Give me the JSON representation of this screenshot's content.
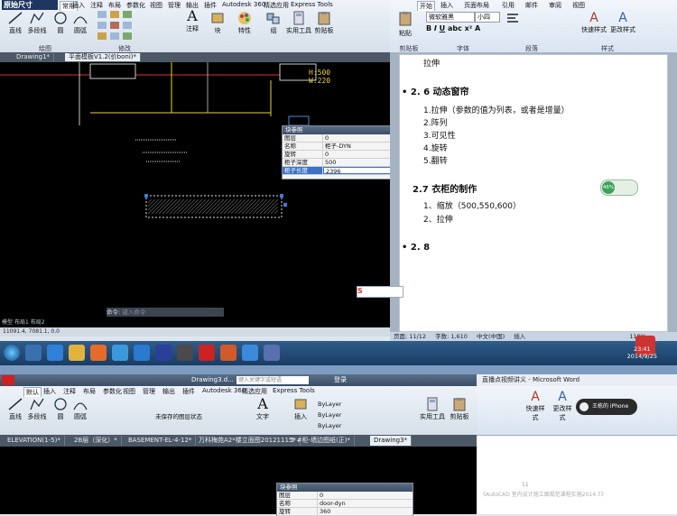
{
  "top_acad": {
    "title_overlay": "原始尺寸",
    "tabs": [
      "常用",
      "插入",
      "注释",
      "布局",
      "参数化",
      "视图",
      "管理",
      "输出",
      "插件",
      "Autodesk 360",
      "精选应用",
      "Express Tools"
    ],
    "tools": [
      "直线",
      "多段线",
      "圆",
      "圆弧",
      "注释",
      "块",
      "特性",
      "组",
      "实用工具",
      "剪贴板"
    ],
    "groups": [
      "绘图",
      "修改"
    ],
    "doc_tabs": [
      "Drawing1*",
      "平面模板V1.2(价boni)*"
    ],
    "dim_text_1": "H:500",
    "dim_text_2": "W:220",
    "command_label": "命令:",
    "command_placeholder": "键入命令",
    "status_text": "11091.4, 7081.1, 0.0",
    "status_tabs": [
      "模型",
      "布局1",
      "布局2"
    ],
    "block_panel": {
      "title": "块参照",
      "rows": [
        {
          "k": "图层",
          "v": "0"
        },
        {
          "k": "名称",
          "v": "柜子-DYN"
        },
        {
          "k": "旋转",
          "v": "0"
        },
        {
          "k": "柜子深度",
          "v": "500"
        },
        {
          "k": "柜子长度",
          "v": "2396"
        }
      ]
    }
  },
  "top_word": {
    "tabs": [
      "开始",
      "插入",
      "页面布局",
      "引用",
      "邮件",
      "审阅",
      "视图"
    ],
    "font_name": "微软雅黑",
    "font_size": "小四",
    "groups": [
      "剪贴板",
      "字体",
      "段落",
      "样式"
    ],
    "style_buttons": [
      "快速样式",
      "更改样式"
    ],
    "paste_label": "粘贴",
    "lines": [
      {
        "t": "拉伸",
        "h": false
      },
      {
        "t": "• 2. 6 动态窗帘",
        "h": true
      },
      {
        "t": "1.拉伸（参数的值为列表，或者是增量）",
        "h": false
      },
      {
        "t": "2.阵列",
        "h": false
      },
      {
        "t": "3.可见性",
        "h": false
      },
      {
        "t": "4.旋转",
        "h": false
      },
      {
        "t": "5.翻转",
        "h": false
      },
      {
        "t": "2.7 衣柜的制作",
        "h": true
      },
      {
        "t": "1、缩放（500,550,600）",
        "h": false
      },
      {
        "t": "2、拉伸",
        "h": false
      },
      {
        "t": "• 2. 8",
        "h": true
      }
    ],
    "status_page": "页面: 11/12",
    "status_words": "字数: 1,610",
    "status_lang": "中文(中国)",
    "status_mode": "插入",
    "zoom": "110%",
    "net_percent": "46%"
  },
  "taskbar": {
    "time": "23:41",
    "date": "2014/9/25"
  },
  "bottom_acad": {
    "title": "Drawing3.d...",
    "search_placeholder": "键入关键字或短语",
    "login": "登录",
    "tabs": [
      "默认",
      "插入",
      "注释",
      "布局",
      "参数化",
      "视图",
      "管理",
      "输出",
      "插件",
      "Autodesk 360",
      "精选应用",
      "Express Tools"
    ],
    "tools": [
      "直线",
      "多段线",
      "圆",
      "圆弧",
      "文字",
      "插入",
      "特性匹配",
      "实用工具",
      "剪贴板"
    ],
    "layer_label": "未保存的图层状态",
    "bylayer": "ByLayer",
    "groups": [
      "绘图",
      "修改",
      "图层",
      "注释",
      "块",
      "特性",
      "组"
    ],
    "doc_tabs": [
      "ELEVATION(1-5)*",
      "2B层（深化）*",
      "BASEMENT-EL-4-12*",
      "万科梅苑A2*楼立面图20121115*",
      "5 #柜-墙边图纸(正)*",
      "Drawing3*"
    ],
    "block_panel": {
      "title": "块参照",
      "rows": [
        {
          "k": "图层",
          "v": "0"
        },
        {
          "k": "名称",
          "v": "door-dyn"
        },
        {
          "k": "旋转",
          "v": "360"
        }
      ]
    }
  },
  "bottom_word": {
    "title": "直播点视频讲义 - Microsoft Word",
    "style_buttons": [
      "快速样式",
      "更改样式"
    ],
    "iphone_label": "王栋的 iPhone",
    "caption": "《AutoCAD 室内设计施工图规范课程实施2014.7》",
    "page_num": "11"
  }
}
